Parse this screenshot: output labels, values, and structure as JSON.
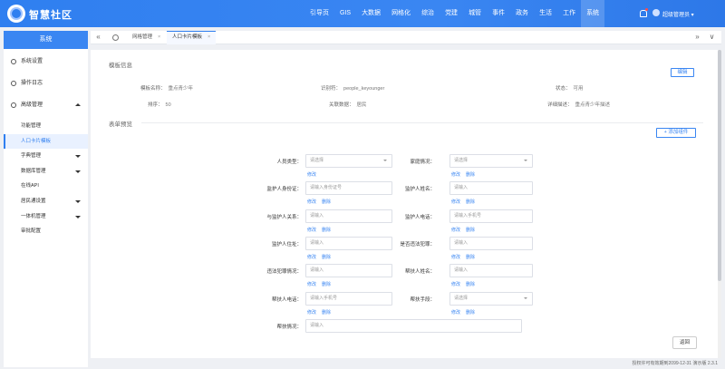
{
  "header": {
    "brand": "智慧社区",
    "nav": [
      "引导页",
      "GIS",
      "大数据",
      "网格化",
      "综治",
      "党建",
      "城管",
      "事件",
      "政务",
      "生活",
      "工作",
      "系统"
    ],
    "active_nav_index": 11,
    "admin": "超级管理员 ▾"
  },
  "sidebar": {
    "title": "系统",
    "top_items": [
      "系统设置",
      "操作日志",
      "高级管理"
    ],
    "sub_items": [
      "功能管理",
      "人口卡片模板",
      "字典管理",
      "数据库管理",
      "在线API",
      "居民通设置",
      "一体机管理",
      "审批配置"
    ],
    "active_sub_index": 1
  },
  "tabs": {
    "prev": "«",
    "next": "»",
    "close_all": "∨",
    "items": [
      {
        "label": "网格管理",
        "close": "×"
      },
      {
        "label": "人口卡片模板",
        "close": "×"
      }
    ],
    "active_index": 1
  },
  "template_info": {
    "section_title": "模板信息",
    "edit_label": "编辑",
    "fields": [
      {
        "label": "模板名称：",
        "value": "重点青少年"
      },
      {
        "label": "识别符：",
        "value": "people_keyounger"
      },
      {
        "label": "状态：",
        "value": "可用"
      },
      {
        "label": "排序：",
        "value": "50"
      },
      {
        "label": "关联数据：",
        "value": "居民"
      },
      {
        "label": "详细描述：",
        "value": "重点青少年描述"
      }
    ]
  },
  "form_preview": {
    "section_title": "表单预览",
    "add_label": "+ 添加组件",
    "edit_action": "修改",
    "delete_action": "删除",
    "fields": [
      {
        "label": "人员类型：",
        "placeholder": "请选择",
        "select": true
      },
      {
        "label": "家庭情况：",
        "placeholder": "请选择",
        "select": true
      },
      {
        "label": "监护人身份证：",
        "placeholder": "请输入身份证号",
        "select": false
      },
      {
        "label": "监护人姓名：",
        "placeholder": "请输入",
        "select": false
      },
      {
        "label": "与监护人关系：",
        "placeholder": "请输入",
        "select": false
      },
      {
        "label": "监护人电话：",
        "placeholder": "请输入手机号",
        "select": false
      },
      {
        "label": "监护人住址：",
        "placeholder": "请输入",
        "select": false
      },
      {
        "label": "是否违法犯罪：",
        "placeholder": "请输入",
        "select": false
      },
      {
        "label": "违法犯罪情况：",
        "placeholder": "请输入",
        "select": false
      },
      {
        "label": "帮扶人姓名：",
        "placeholder": "请输入",
        "select": false
      },
      {
        "label": "帮扶人电话：",
        "placeholder": "请输入手机号",
        "select": false
      },
      {
        "label": "帮扶手段：",
        "placeholder": "请选择",
        "select": true
      },
      {
        "label": "帮扶情况：",
        "placeholder": "请输入",
        "select": false
      }
    ],
    "back_label": "返回"
  },
  "footer": {
    "text": "授权许可有效期到2099-12-31 演示版  2.3.1"
  }
}
